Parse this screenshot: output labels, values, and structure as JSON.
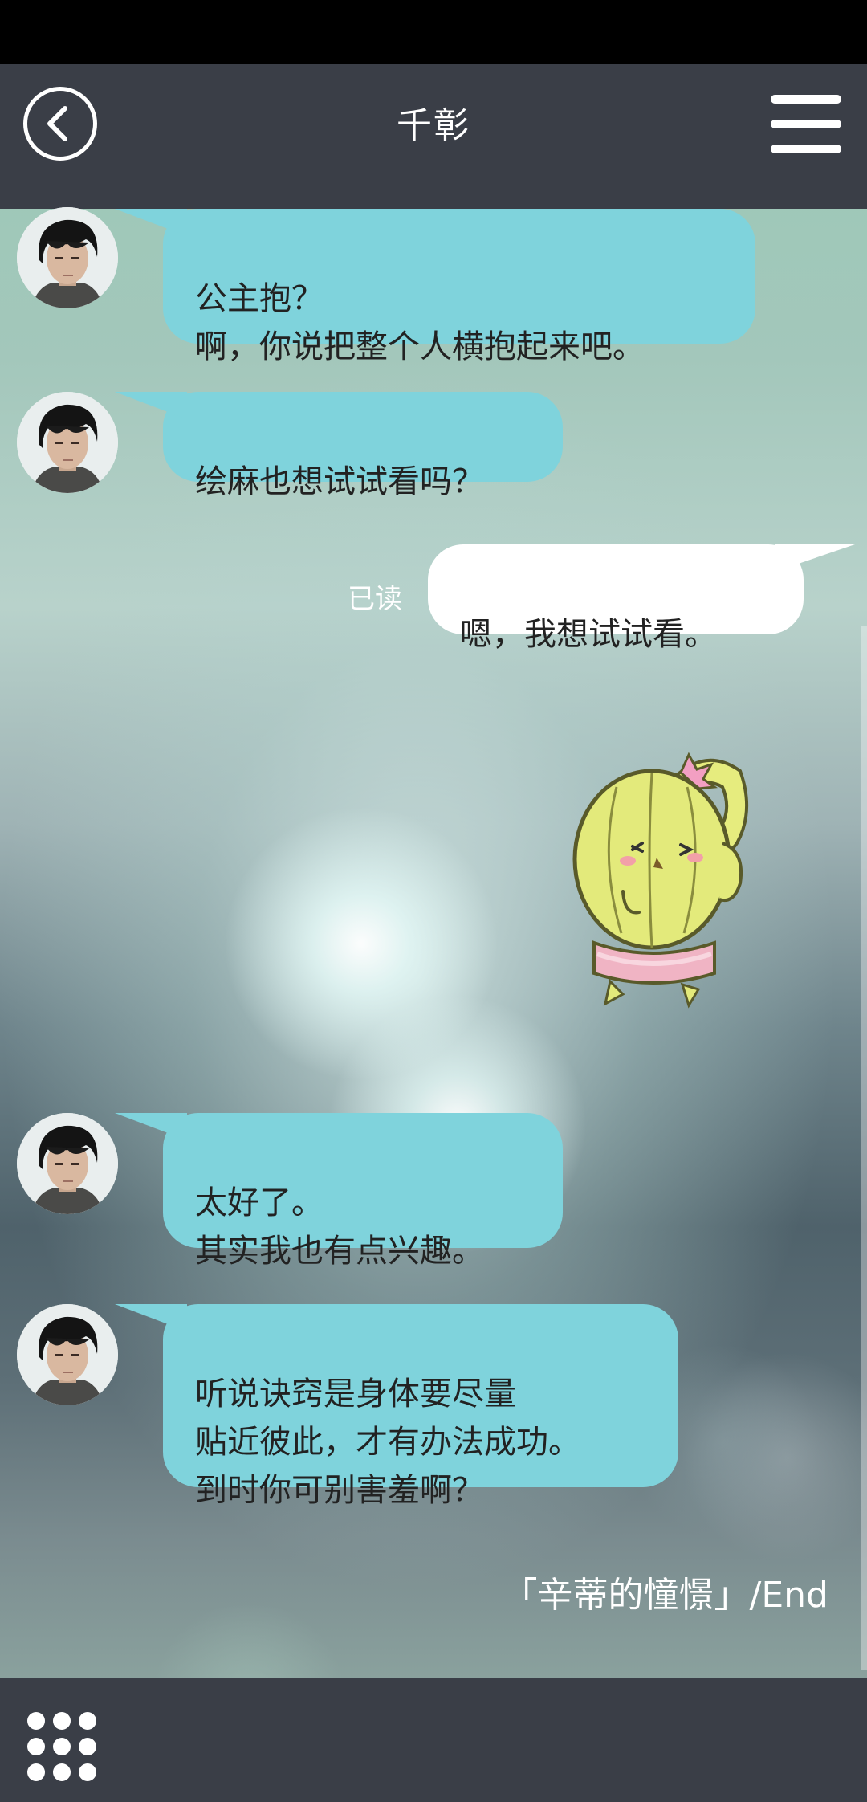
{
  "header": {
    "title": "千彰",
    "back_label": "",
    "menu_label": ""
  },
  "messages": [
    {
      "sender": "千彰",
      "side": "incoming",
      "text": "公主抱？\n啊，你说把整个人横抱起来吧。"
    },
    {
      "sender": "千彰",
      "side": "incoming",
      "text": "绘麻也想试试看吗？"
    },
    {
      "sender": "me",
      "side": "outgoing",
      "text": "嗯，我想试试看。",
      "status": "已读"
    },
    {
      "sender": "me",
      "side": "outgoing",
      "type": "sticker",
      "sticker": "cactus-sticker"
    },
    {
      "sender": "千彰",
      "side": "incoming",
      "text": "太好了。\n其实我也有点兴趣。"
    },
    {
      "sender": "千彰",
      "side": "incoming",
      "text": "听说诀窍是身体要尽量\n贴近彼此，才有办法成功。\n到时你可别害羞啊？"
    }
  ],
  "end_caption": "「辛蒂的憧憬」/End",
  "icons": {
    "back": "back-arrow-icon",
    "menu": "hamburger-menu-icon",
    "apps": "grid-dots-icon"
  },
  "colors": {
    "bar_bg": "#3a3e47",
    "incoming_bubble": "#7fd3dc",
    "outgoing_bubble": "#ffffff"
  }
}
